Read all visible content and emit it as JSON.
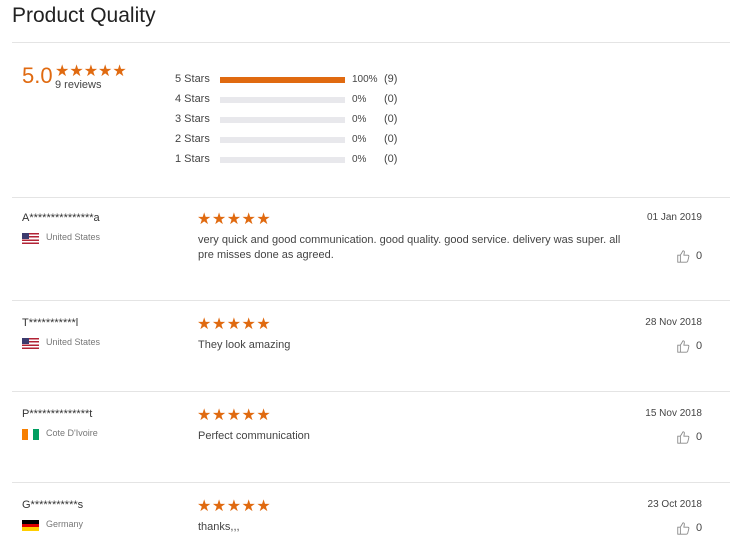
{
  "page": {
    "title": "Product Quality"
  },
  "summary": {
    "average": "5.0",
    "stars": "★★★★★",
    "review_count": "9 reviews",
    "distribution": [
      {
        "label": "5 Stars",
        "fill": 1.0,
        "percent": "100%",
        "count": "(9)"
      },
      {
        "label": "4 Stars",
        "fill": 0.0,
        "percent": "0%",
        "count": "(0)"
      },
      {
        "label": "3 Stars",
        "fill": 0.0,
        "percent": "0%",
        "count": "(0)"
      },
      {
        "label": "2 Stars",
        "fill": 0.0,
        "percent": "0%",
        "count": "(0)"
      },
      {
        "label": "1 Stars",
        "fill": 0.0,
        "percent": "0%",
        "count": "(0)"
      }
    ]
  },
  "reviews": [
    {
      "name": "A***************a",
      "country": "United States",
      "flag": "us",
      "stars": "★★★★★",
      "text": "very quick and good communication. good quality. good service. delivery was super. all pre misses done as agreed.",
      "date": "01 Jan 2019",
      "likes": "0"
    },
    {
      "name": "T***********l",
      "country": "United States",
      "flag": "us",
      "stars": "★★★★★",
      "text": "They look amazing",
      "date": "28 Nov 2018",
      "likes": "0"
    },
    {
      "name": "P**************t",
      "country": "Cote D'Ivoire",
      "flag": "ci",
      "stars": "★★★★★",
      "text": "Perfect communication",
      "date": "15 Nov 2018",
      "likes": "0"
    },
    {
      "name": "G***********s",
      "country": "Germany",
      "flag": "de",
      "stars": "★★★★★",
      "text": "thanks,,,",
      "date": "23 Oct 2018",
      "likes": "0"
    }
  ],
  "colors": {
    "accent": "#e06a10",
    "track": "#e8e8ec",
    "rule": "#e4e4e4"
  },
  "icons": {
    "like": "thumbs-up-icon",
    "star": "star-icon"
  }
}
